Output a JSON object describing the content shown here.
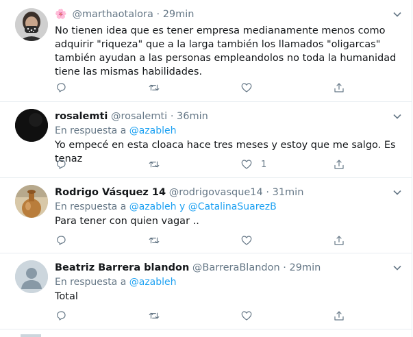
{
  "tweets": [
    {
      "prefix_emoji": "🌸",
      "name": "",
      "handle": "@marthaotalora",
      "time": "29min",
      "reply_prefix": "",
      "reply_mentions": [],
      "text": "No tienen idea que es tener empresa medianamente menos como adquirir \"riqueza\" que a la larga también los llamados \"oligarcas\" también ayudan a las personas empleandolos no toda la humanidad tiene las mismas habilidades.",
      "like_count": ""
    },
    {
      "name": "rosalemti",
      "handle": "@rosalemti",
      "time": "36min",
      "reply_prefix": "En respuesta a",
      "reply_mentions": [
        "@azableh"
      ],
      "text": "Yo empecé en esta cloaca hace tres meses y estoy que me salgo. Es tenaz",
      "like_count": "1"
    },
    {
      "name": "Rodrigo Vásquez 14",
      "handle": "@rodrigovasque14",
      "time": "31min",
      "reply_prefix": "En respuesta a",
      "reply_mentions": [
        "@azableh",
        "@CatalinaSuarezB"
      ],
      "reply_joiner": "y",
      "text": "Para tener con quien vagar ..",
      "like_count": ""
    },
    {
      "name": "Beatriz Barrera blandon",
      "handle": "@BarreraBlandon",
      "time": "29min",
      "reply_prefix": "En respuesta a",
      "reply_mentions": [
        "@azableh"
      ],
      "text": "Total",
      "like_count": ""
    }
  ],
  "separator": "·",
  "icons": {
    "reply": "reply-icon",
    "retweet": "retweet-icon",
    "like": "heart-icon",
    "share": "share-icon",
    "more": "chevron-down-icon"
  },
  "colors": {
    "link": "#1da1f2",
    "muted": "#657786",
    "text": "#14171a",
    "border": "#e6ecf0"
  }
}
